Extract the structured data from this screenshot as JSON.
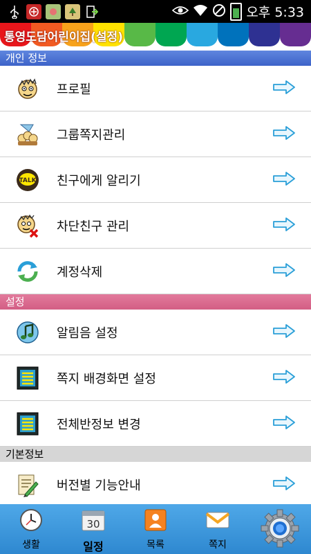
{
  "status_bar": {
    "time": "오후 5:33",
    "left_icons": [
      "usb-icon",
      "app-notify-icon",
      "gallery-icon",
      "tree-icon",
      "download-icon"
    ],
    "right_icons": [
      "eye-icon",
      "wifi-icon",
      "no-signal-icon",
      "battery-icon"
    ]
  },
  "app": {
    "title": "통영도담어린이집(설정)",
    "stripe_colors": [
      "#e8161b",
      "#f15a22",
      "#f7a21b",
      "#ffe200",
      "#58b947",
      "#00a651",
      "#29a8e0",
      "#0072bc",
      "#2e3192",
      "#662d91"
    ]
  },
  "sections": [
    {
      "title": "개인 정보",
      "items": [
        {
          "label": "프로필",
          "icon": "profile-face-icon"
        },
        {
          "label": "그룹쪽지관리",
          "icon": "group-message-icon"
        },
        {
          "label": "친구에게 알리기",
          "icon": "kakaotalk-icon",
          "icon_text": "TALK"
        },
        {
          "label": "차단친구 관리",
          "icon": "blocked-friend-icon"
        },
        {
          "label": "계정삭제",
          "icon": "refresh-account-icon"
        }
      ]
    },
    {
      "title": "설정",
      "items": [
        {
          "label": "알림음 설정",
          "icon": "music-note-icon"
        },
        {
          "label": "쪽지 배경화면 설정",
          "icon": "background-list-icon"
        },
        {
          "label": "전체반정보 변경",
          "icon": "class-list-icon"
        }
      ]
    },
    {
      "title": "기본정보",
      "items": [
        {
          "label": "버전별 기능안내",
          "icon": "document-pen-icon"
        }
      ]
    }
  ],
  "tabs": [
    {
      "label": "생활",
      "icon": "clock-icon"
    },
    {
      "label": "일정",
      "icon": "calendar-icon",
      "icon_text": "30",
      "active": true
    },
    {
      "label": "목록",
      "icon": "contacts-icon"
    },
    {
      "label": "쪽지",
      "icon": "envelope-icon"
    },
    {
      "label": "",
      "icon": "settings-gear-icon"
    }
  ]
}
